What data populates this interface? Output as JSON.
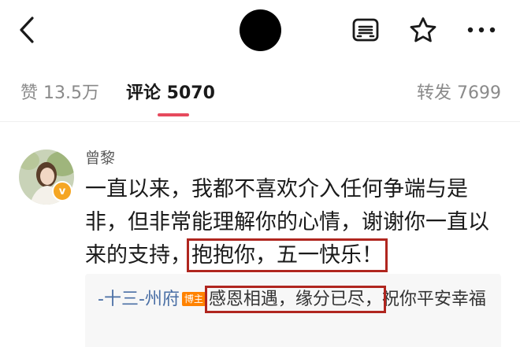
{
  "header": {
    "back_icon": "chevron-left-icon",
    "doc_icon": "document-list-icon",
    "star_icon": "star-icon",
    "more_icon": "more-horizontal-icon"
  },
  "tabs": {
    "like": "赞 13.5万",
    "comment": "评论 5070",
    "repost": "转发 7699",
    "active_color": "#e64a5d"
  },
  "comment": {
    "author": "曾黎",
    "verified_icon": "verified-v-icon",
    "text_part1": "一直以来，我都不喜欢介入任何争端与是非，但非常能理解你的心情，谢谢你一直以来的支持，",
    "text_highlight": "抱抱你，五一快乐！"
  },
  "reply": {
    "author": "-十三-州府",
    "author_badge": "博主",
    "text_highlight": "感恩相遇，缘分已尽，",
    "text_rest": "祝你平安幸福"
  },
  "colors": {
    "highlight_border": "#b0261f",
    "link_blue": "#4a6fa5",
    "badge_orange": "#ff8200",
    "verified_gold": "#f5a623"
  }
}
